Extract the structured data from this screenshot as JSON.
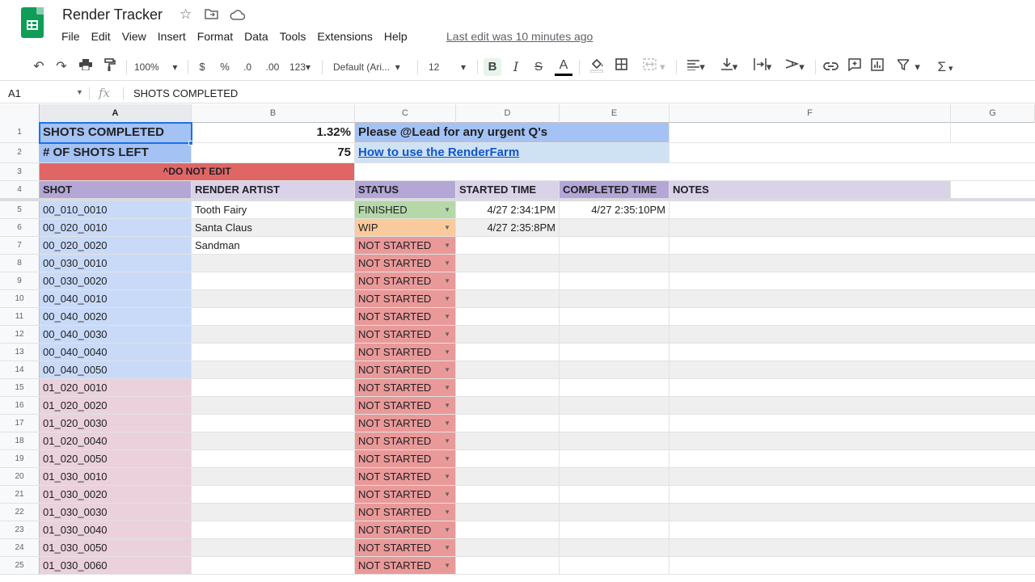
{
  "app": {
    "doc_title": "Render Tracker",
    "menus": [
      "File",
      "Edit",
      "View",
      "Insert",
      "Format",
      "Data",
      "Tools",
      "Extensions",
      "Help"
    ],
    "last_edit": "Last edit was 10 minutes ago"
  },
  "toolbar": {
    "zoom": "100%",
    "currency": "$",
    "percent": "%",
    "dec_decrease": ".0",
    "dec_increase": ".00",
    "number_format": "123",
    "font": "Default (Ari...",
    "font_size": "12",
    "bold": "B",
    "italic": "I",
    "strike": "S",
    "text_color": "A",
    "sigma": "Σ"
  },
  "formula_bar": {
    "name_box": "A1",
    "fx": "fx",
    "value": "SHOTS COMPLETED"
  },
  "columns": [
    "A",
    "B",
    "C",
    "D",
    "E",
    "F",
    "G"
  ],
  "colors": {
    "blue_header": "#a4c2f4",
    "light_blue": "#cfe2f3",
    "shot_blue": "#c9daf8",
    "shot_pink": "#ead1dc",
    "red": "#e06666",
    "red_status": "#ea9999",
    "green": "#b6d7a8",
    "orange": "#f9cb9c",
    "purple_header": "#b4a7d6",
    "lavender": "#d9d2e9",
    "link": "#1155cc"
  },
  "summary": {
    "r1": {
      "label": "SHOTS COMPLETED",
      "value": "1.32%",
      "note": "Please @Lead for any urgent Q's"
    },
    "r2": {
      "label": "# OF SHOTS LEFT",
      "value": "75",
      "link": "How to use the RenderFarm"
    },
    "r3": {
      "warning": "^DO NOT EDIT"
    }
  },
  "table_headers": {
    "shot": "SHOT",
    "artist": "RENDER ARTIST",
    "status": "STATUS",
    "started": "STARTED TIME",
    "completed": "COMPLETED TIME",
    "notes": "NOTES"
  },
  "rows": [
    {
      "num": "5",
      "shot": "00_010_0010",
      "artist": "Tooth Fairy",
      "status": "FINISHED",
      "started": "4/27 2:34:1PM",
      "completed": "4/27 2:35:10PM"
    },
    {
      "num": "6",
      "shot": "00_020_0010",
      "artist": "Santa Claus",
      "status": "WIP",
      "started": "4/27 2:35:8PM",
      "completed": ""
    },
    {
      "num": "7",
      "shot": "00_020_0020",
      "artist": "Sandman",
      "status": "NOT STARTED",
      "started": "",
      "completed": ""
    },
    {
      "num": "8",
      "shot": "00_030_0010",
      "artist": "",
      "status": "NOT STARTED",
      "started": "",
      "completed": ""
    },
    {
      "num": "9",
      "shot": "00_030_0020",
      "artist": "",
      "status": "NOT STARTED",
      "started": "",
      "completed": ""
    },
    {
      "num": "10",
      "shot": "00_040_0010",
      "artist": "",
      "status": "NOT STARTED",
      "started": "",
      "completed": ""
    },
    {
      "num": "11",
      "shot": "00_040_0020",
      "artist": "",
      "status": "NOT STARTED",
      "started": "",
      "completed": ""
    },
    {
      "num": "12",
      "shot": "00_040_0030",
      "artist": "",
      "status": "NOT STARTED",
      "started": "",
      "completed": ""
    },
    {
      "num": "13",
      "shot": "00_040_0040",
      "artist": "",
      "status": "NOT STARTED",
      "started": "",
      "completed": ""
    },
    {
      "num": "14",
      "shot": "00_040_0050",
      "artist": "",
      "status": "NOT STARTED",
      "started": "",
      "completed": ""
    },
    {
      "num": "15",
      "shot": "01_020_0010",
      "artist": "",
      "status": "NOT STARTED",
      "started": "",
      "completed": ""
    },
    {
      "num": "16",
      "shot": "01_020_0020",
      "artist": "",
      "status": "NOT STARTED",
      "started": "",
      "completed": ""
    },
    {
      "num": "17",
      "shot": "01_020_0030",
      "artist": "",
      "status": "NOT STARTED",
      "started": "",
      "completed": ""
    },
    {
      "num": "18",
      "shot": "01_020_0040",
      "artist": "",
      "status": "NOT STARTED",
      "started": "",
      "completed": ""
    },
    {
      "num": "19",
      "shot": "01_020_0050",
      "artist": "",
      "status": "NOT STARTED",
      "started": "",
      "completed": ""
    },
    {
      "num": "20",
      "shot": "01_030_0010",
      "artist": "",
      "status": "NOT STARTED",
      "started": "",
      "completed": ""
    },
    {
      "num": "21",
      "shot": "01_030_0020",
      "artist": "",
      "status": "NOT STARTED",
      "started": "",
      "completed": ""
    },
    {
      "num": "22",
      "shot": "01_030_0030",
      "artist": "",
      "status": "NOT STARTED",
      "started": "",
      "completed": ""
    },
    {
      "num": "23",
      "shot": "01_030_0040",
      "artist": "",
      "status": "NOT STARTED",
      "started": "",
      "completed": ""
    },
    {
      "num": "24",
      "shot": "01_030_0050",
      "artist": "",
      "status": "NOT STARTED",
      "started": "",
      "completed": ""
    },
    {
      "num": "25",
      "shot": "01_030_0060",
      "artist": "",
      "status": "NOT STARTED",
      "started": "",
      "completed": ""
    }
  ]
}
